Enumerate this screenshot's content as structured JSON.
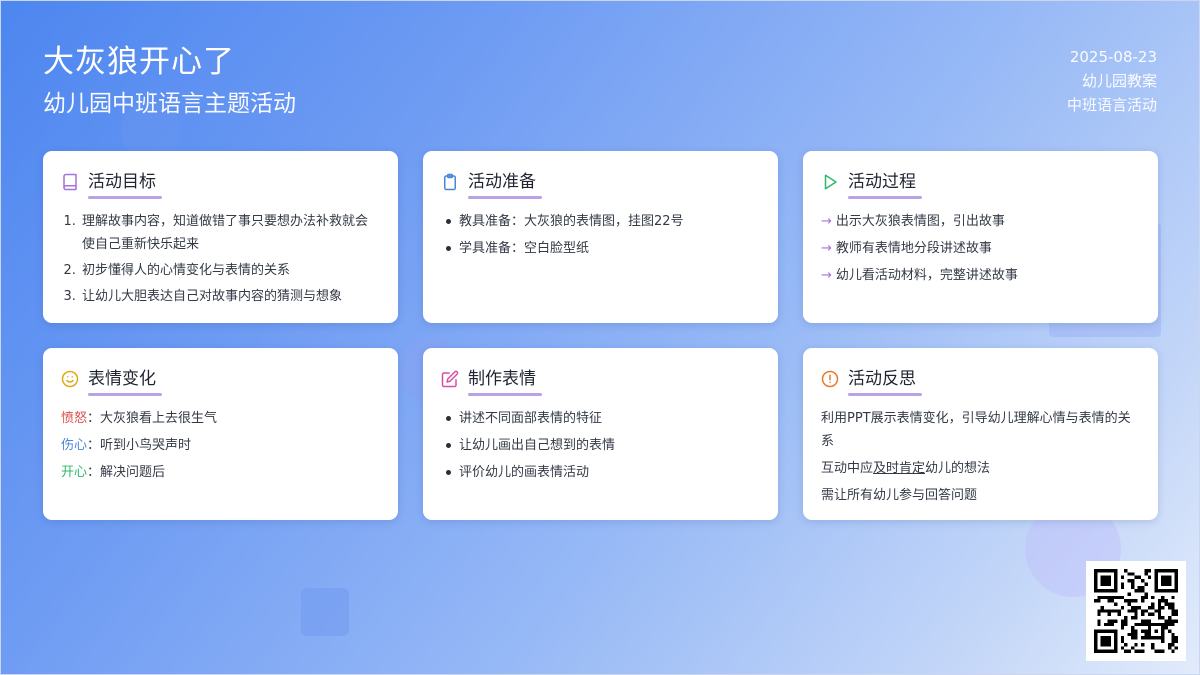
{
  "header": {
    "title": "大灰狼开心了",
    "subtitle": "幼儿园中班语言主题活动",
    "date": "2025-08-23",
    "doc_type": "幼儿园教案",
    "category": "中班语言活动"
  },
  "cards": {
    "goals": {
      "icon": "book-icon",
      "title": "活动目标",
      "accent": "#a472d8",
      "items": [
        "理解故事内容，知道做错了事只要想办法补救就会使自己重新快乐起来",
        "初步懂得人的心情变化与表情的关系",
        "让幼儿大胆表达自己对故事内容的猜测与想象"
      ]
    },
    "prep": {
      "icon": "clipboard-icon",
      "title": "活动准备",
      "accent": "#4a86d8",
      "items": [
        "教具准备：大灰狼的表情图，挂图22号",
        "学具准备：空白脸型纸"
      ]
    },
    "process": {
      "icon": "play-icon",
      "title": "活动过程",
      "accent": "#2fb86a",
      "arrow": "→",
      "items": [
        "出示大灰狼表情图，引出故事",
        "教师有表情地分段讲述故事",
        "幼儿看活动材料，完整讲述故事"
      ]
    },
    "emotions": {
      "icon": "smile-icon",
      "title": "表情变化",
      "accent": "#e0a91a",
      "items": [
        {
          "label": "愤怒",
          "text": "：大灰狼看上去很生气",
          "color": "#d9534f"
        },
        {
          "label": "伤心",
          "text": "：听到小鸟哭声时",
          "color": "#4a86d8"
        },
        {
          "label": "开心",
          "text": "：解决问题后",
          "color": "#2fb86a"
        }
      ]
    },
    "make": {
      "icon": "edit-icon",
      "title": "制作表情",
      "accent": "#d94fa0",
      "items": [
        "讲述不同面部表情的特征",
        "让幼儿画出自己想到的表情",
        "评价幼儿的画表情活动"
      ]
    },
    "reflection": {
      "icon": "alert-circle-icon",
      "title": "活动反思",
      "accent": "#e87a2a",
      "p1": "利用PPT展示表情变化，引导幼儿理解心情与表情的关系",
      "p2_pre": "互动中应",
      "p2_mark": "及时肯定",
      "p2_post": "幼儿的想法",
      "p3": "需让所有幼儿参与回答问题"
    }
  },
  "qr_icon": "qr-code-icon"
}
